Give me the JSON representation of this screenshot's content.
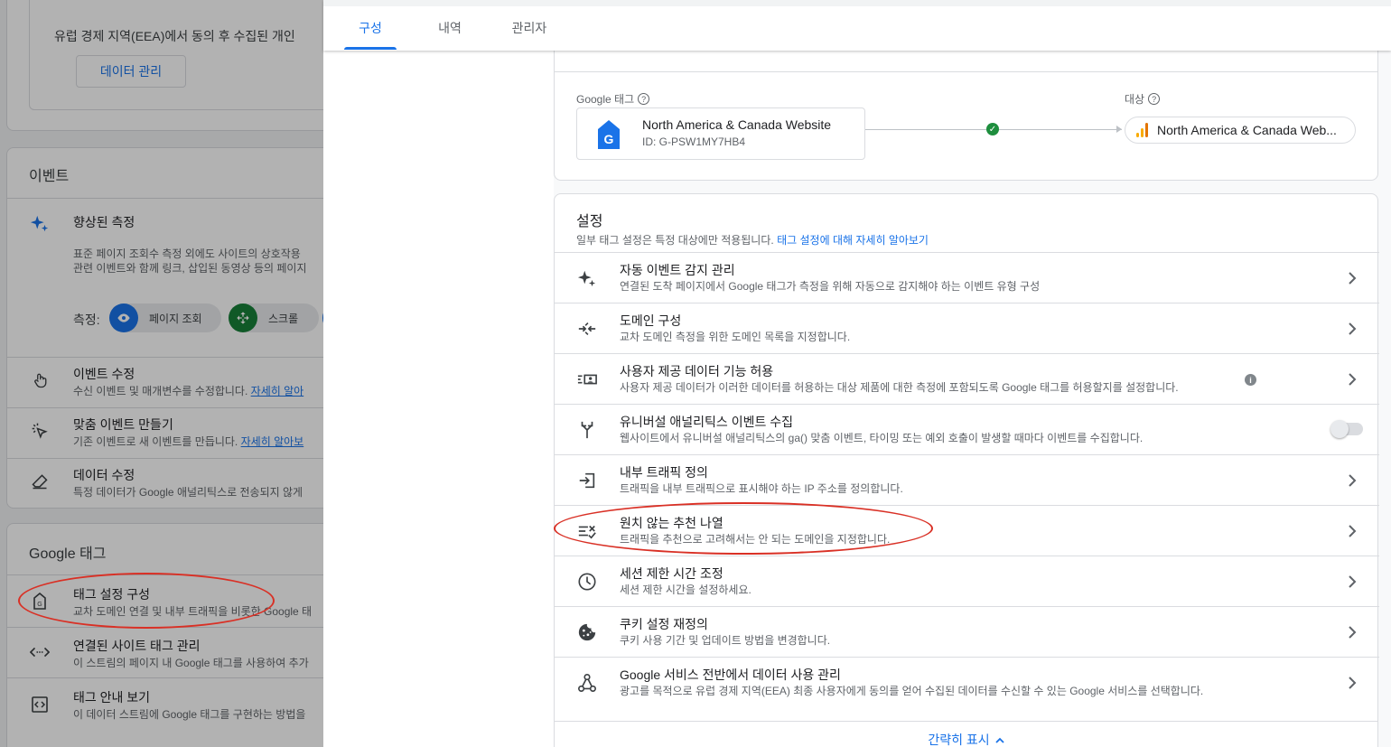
{
  "left_panel": {
    "top_card": {
      "description": "유럽 경제 지역(EEA)에서 동의 후 수집된 개인",
      "manage_button": "데이터 관리"
    },
    "events": {
      "heading": "이벤트",
      "enhanced": {
        "title": "향상된 측정",
        "line1": "표준 페이지 조회수 측정 외에도 사이트의 상호작용",
        "line2": "관련 이벤트와 함께 링크, 삽입된 동영상 등의 페이지",
        "measure_label": "측정:",
        "chips": [
          "페이지 조회",
          "스크롤"
        ]
      },
      "rows": [
        {
          "title": "이벤트 수정",
          "sub": "수신 이벤트 및 매개변수를 수정합니다.",
          "link": "자세히 알아"
        },
        {
          "title": "맞춤 이벤트 만들기",
          "sub": "기존 이벤트로 새 이벤트를 만듭니다.",
          "link": "자세히 알아보"
        },
        {
          "title": "데이터 수정",
          "sub": "특정 데이터가 Google 애널리틱스로 전송되지 않게",
          "link": ""
        }
      ]
    },
    "gtag": {
      "heading": "Google 태그",
      "rows": [
        {
          "title": "태그 설정 구성",
          "sub": "교차 도메인 연결 및 내부 트래픽을 비롯한 Google 태"
        },
        {
          "title": "연결된 사이트 태그 관리",
          "sub": "이 스트림의 페이지 내 Google 태그를 사용하여 추가"
        },
        {
          "title": "태그 안내 보기",
          "sub": "이 데이터 스트림에 Google 태그를 구현하는 방법을"
        }
      ]
    }
  },
  "tabs": [
    "구성",
    "내역",
    "관리자"
  ],
  "active_tab": "구성",
  "connection": {
    "tag_label": "Google 태그",
    "dest_label": "대상",
    "tag_name": "North America & Canada Website",
    "tag_id": "ID: G-PSW1MY7HB4",
    "destination": "North America & Canada Web..."
  },
  "settings": {
    "title": "설정",
    "subtitle": "일부 태그 설정은 특정 대상에만 적용됩니다.",
    "subtitle_link": "태그 설정에 대해 자세히 알아보기",
    "rows": [
      {
        "icon": "sparkle-icon",
        "title": "자동 이벤트 감지 관리",
        "sub": "연결된 도착 페이지에서 Google 태그가 측정을 위해 자동으로 감지해야 하는 이벤트 유형 구성",
        "control": "chevron"
      },
      {
        "icon": "merge-arrows-icon",
        "title": "도메인 구성",
        "sub": "교차 도메인 측정을 위한 도메인 목록을 지정합니다.",
        "control": "chevron"
      },
      {
        "icon": "user-data-icon",
        "title": "사용자 제공 데이터 기능 허용",
        "sub": "사용자 제공 데이터가 이러한 데이터를 허용하는 대상 제품에 대한 측정에 포함되도록 Google 태그를 허용할지를 설정합니다.",
        "control": "chevron",
        "info": true
      },
      {
        "icon": "fork-icon",
        "title": "유니버설 애널리틱스 이벤트 수집",
        "sub": "웹사이트에서 유니버설 애널리틱스의 ga() 맞춤 이벤트, 타이밍 또는 예외 호출이 발생할 때마다 이벤트를 수집합니다.",
        "control": "toggle",
        "toggle_on": false
      },
      {
        "icon": "login-icon",
        "title": "내부 트래픽 정의",
        "sub": "트래픽을 내부 트래픽으로 표시해야 하는 IP 주소를 정의합니다.",
        "control": "chevron"
      },
      {
        "icon": "list-remove-icon",
        "title": "원치 않는 추천 나열",
        "sub": "트래픽을 추천으로 고려해서는 안 되는 도메인을 지정합니다.",
        "control": "chevron"
      },
      {
        "icon": "clock-icon",
        "title": "세션 제한 시간 조정",
        "sub": "세션 제한 시간을 설정하세요.",
        "control": "chevron"
      },
      {
        "icon": "cookie-icon",
        "title": "쿠키 설정 재정의",
        "sub": "쿠키 사용 기간 및 업데이트 방법을 변경합니다.",
        "control": "chevron"
      },
      {
        "icon": "people-network-icon",
        "title": "Google 서비스 전반에서 데이터 사용 관리",
        "sub": "광고를 목적으로 유럽 경제 지역(EEA) 최종 사용자에게 동의를 얻어 수집된 데이터를 수신할 수 있는 Google 서비스를 선택합니다.",
        "control": "chevron"
      }
    ],
    "show_less": "간략히 표시"
  },
  "colors": {
    "accent": "#1a73e8",
    "highlight": "#d93025",
    "success": "#1e8e3e",
    "analytics": "#f9ab00"
  }
}
